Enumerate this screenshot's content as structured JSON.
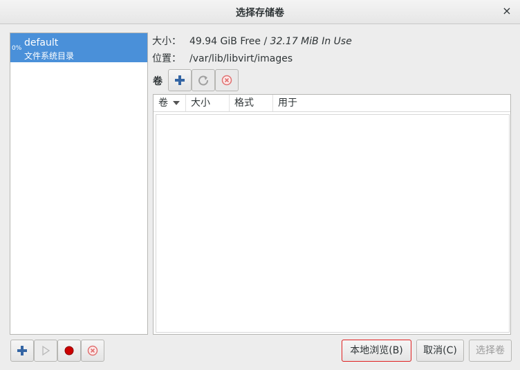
{
  "window": {
    "title": "选择存储卷",
    "close_glyph": "×"
  },
  "pools": [
    {
      "percent": "0%",
      "name": "default",
      "type": "文件系统目录"
    }
  ],
  "info": {
    "size_label": "大小：",
    "free": "49.94 GiB Free /",
    "in_use": "32.17 MiB In Use",
    "location_label": "位置：",
    "location": "/var/lib/libvirt/images"
  },
  "volumes": {
    "label": "卷",
    "toolbar_icons": [
      "add-icon",
      "refresh-icon",
      "delete-icon"
    ],
    "columns": [
      "卷",
      "大小",
      "格式",
      "用于"
    ],
    "rows": []
  },
  "pool_toolbar_icons": [
    "add-icon",
    "play-icon",
    "stop-icon",
    "delete-icon"
  ],
  "buttons": {
    "browse_local": "本地浏览(B)",
    "cancel": "取消(C)",
    "choose_volume": "选择卷"
  },
  "colors": {
    "selection": "#4a90d9",
    "accent_blue": "#3465a4",
    "stop_red": "#cc0000"
  }
}
